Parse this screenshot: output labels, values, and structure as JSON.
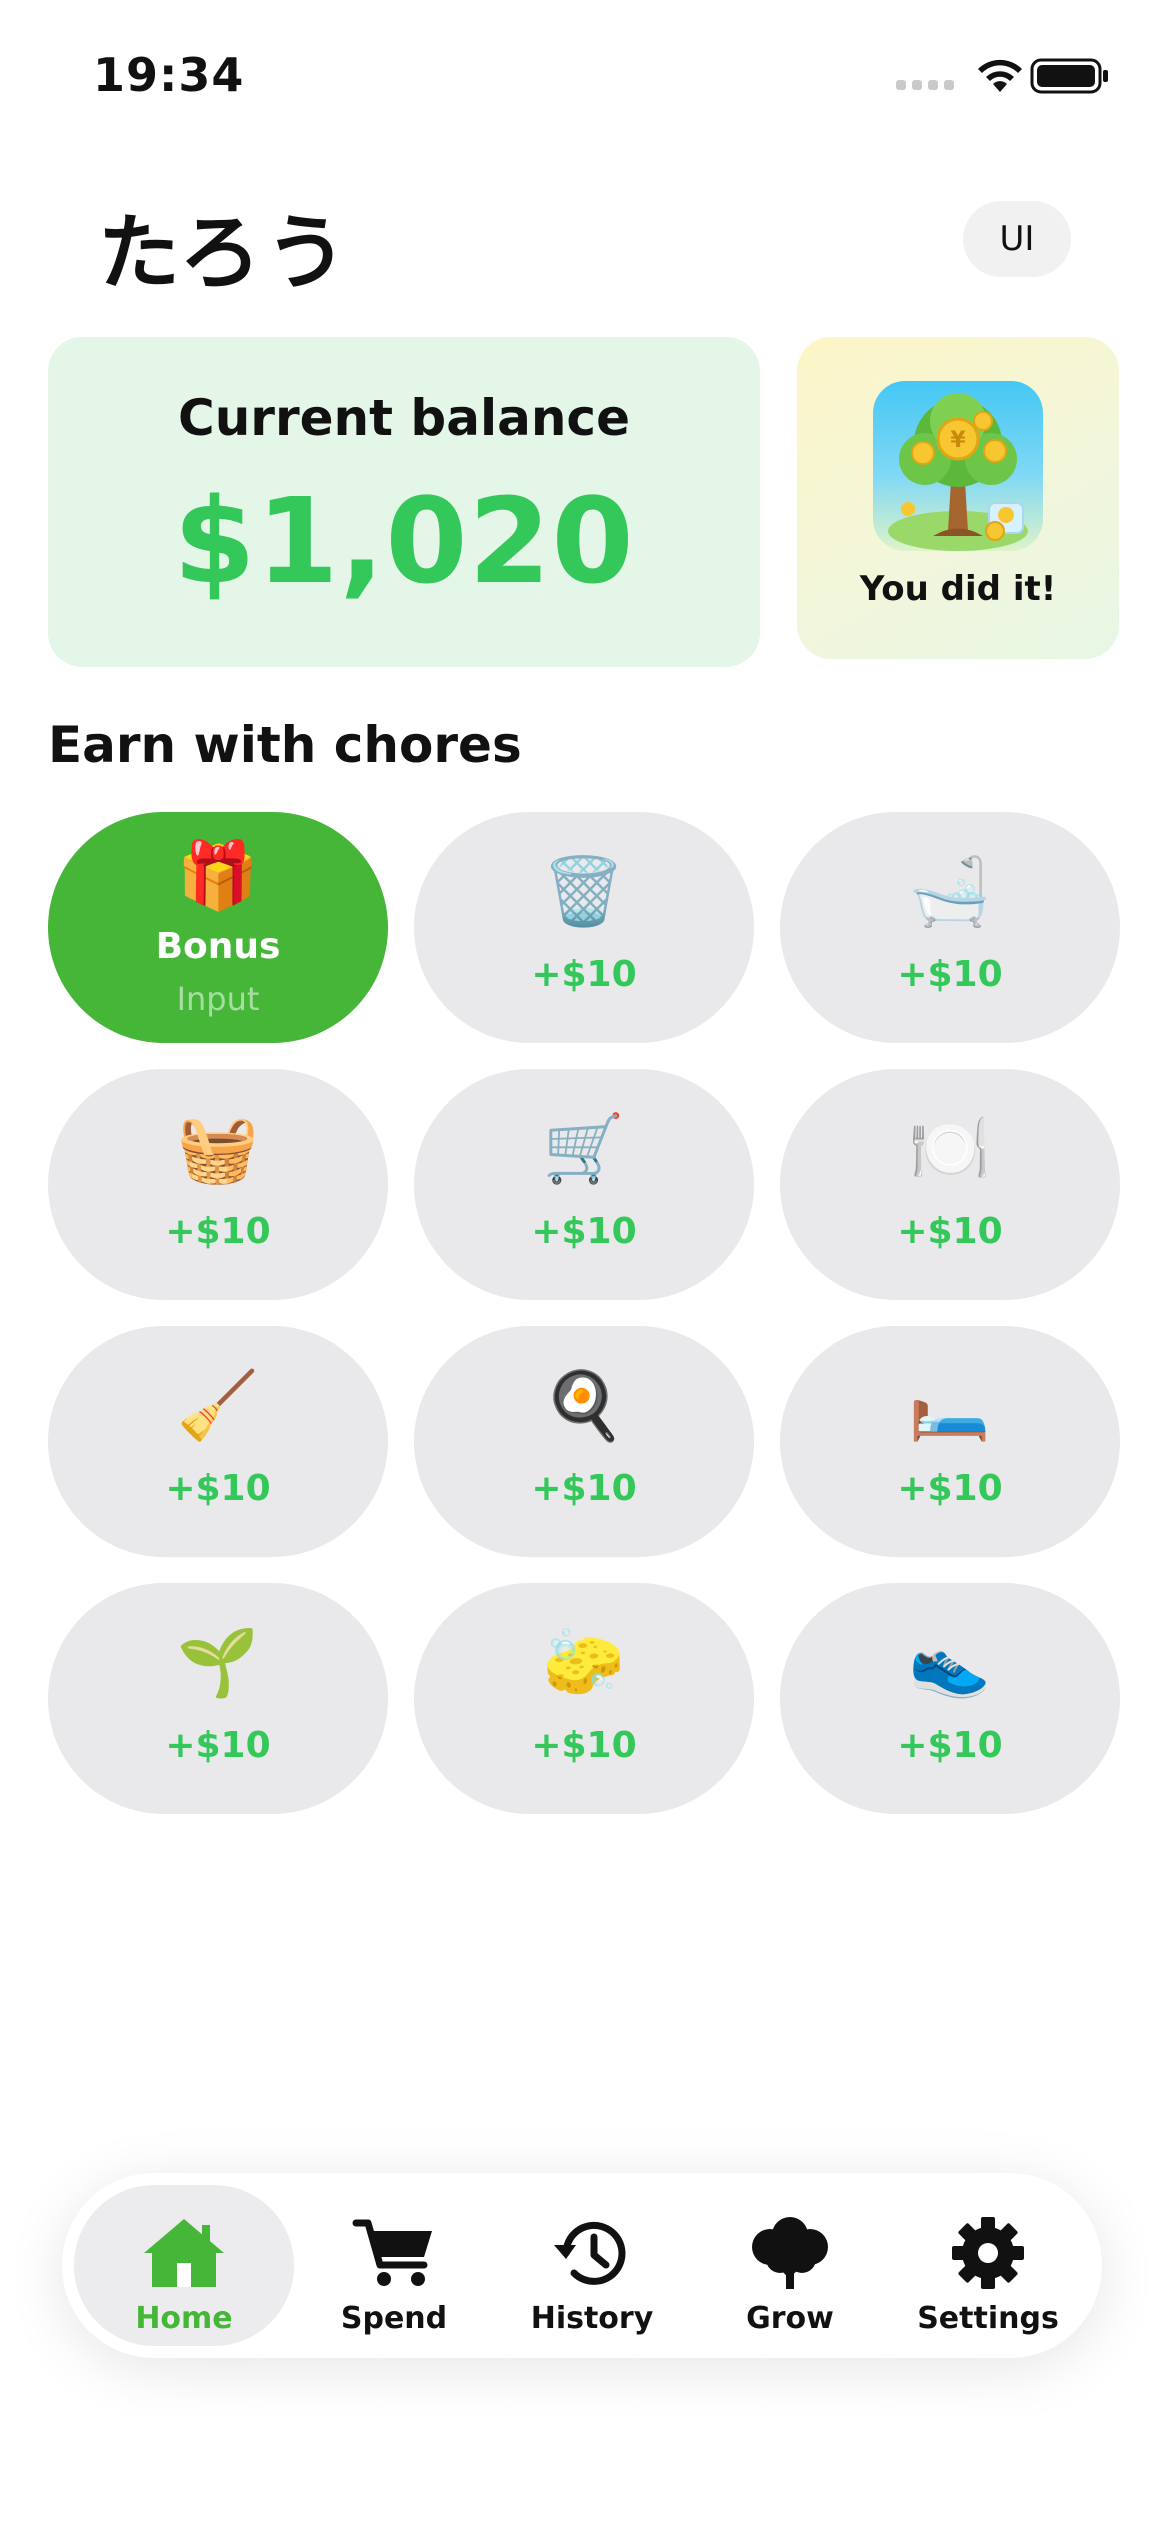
{
  "status_bar": {
    "time": "19:34"
  },
  "header": {
    "child_name": "たろう",
    "lang_button": "UI"
  },
  "balance": {
    "label": "Current balance",
    "amount": "$1,020"
  },
  "achievement": {
    "label": "You did it!",
    "icon": "money-tree-icon"
  },
  "chores_section": {
    "title": "Earn with chores"
  },
  "chores": [
    {
      "emoji": "🎁",
      "label": "Bonus",
      "sublabel": "Input",
      "icon": "gift-icon"
    },
    {
      "emoji": "🗑️",
      "reward": "+$10",
      "icon": "trash-can-icon"
    },
    {
      "emoji": "🛁",
      "reward": "+$10",
      "icon": "bathtub-icon"
    },
    {
      "emoji": "🧺",
      "reward": "+$10",
      "icon": "laundry-basket-icon"
    },
    {
      "emoji": "🛒",
      "reward": "+$10",
      "icon": "shopping-cart-icon"
    },
    {
      "emoji": "🍽️",
      "reward": "+$10",
      "icon": "dishes-icon"
    },
    {
      "emoji": "🧹",
      "reward": "+$10",
      "icon": "broom-icon"
    },
    {
      "emoji": "🍳",
      "reward": "+$10",
      "icon": "frying-pan-icon"
    },
    {
      "emoji": "🛏️",
      "reward": "+$10",
      "icon": "bed-icon"
    },
    {
      "emoji": "🌱",
      "reward": "+$10",
      "icon": "seedling-icon"
    },
    {
      "emoji": "🧽",
      "reward": "+$10",
      "icon": "sponge-icon"
    },
    {
      "emoji": "👟",
      "reward": "+$10",
      "icon": "sneaker-icon"
    }
  ],
  "tabs": [
    {
      "label": "Home",
      "icon": "house-icon",
      "active": true
    },
    {
      "label": "Spend",
      "icon": "cart-icon",
      "active": false
    },
    {
      "label": "History",
      "icon": "history-icon",
      "active": false
    },
    {
      "label": "Grow",
      "icon": "tree-icon",
      "active": false
    },
    {
      "label": "Settings",
      "icon": "gear-icon",
      "active": false
    }
  ],
  "colors": {
    "accent_green": "#34c759",
    "bonus_green": "#45b637",
    "balance_card_bg": "#e4f6e8",
    "chore_bg": "#e9e9eb"
  }
}
